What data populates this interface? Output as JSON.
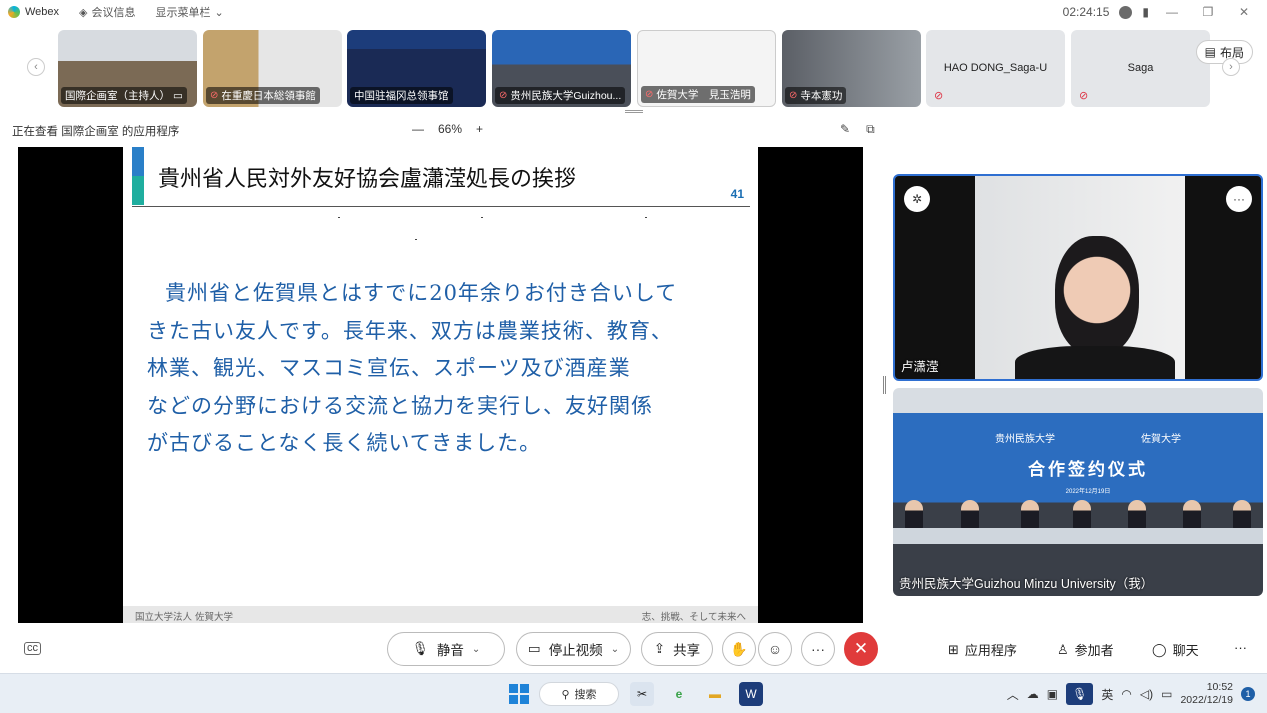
{
  "titlebar": {
    "app_name": "Webex",
    "meeting_info": "会议信息",
    "show_menu": "显示菜单栏",
    "timer": "02:24:15"
  },
  "thumbnails": [
    {
      "label": "国際企画室（主持人）"
    },
    {
      "label": "在重慶日本総領事館"
    },
    {
      "label": "中国驻福冈总领事馆"
    },
    {
      "label": "贵州民族大学Guizhou..."
    },
    {
      "label": "佐賀大学　見玉浩明"
    },
    {
      "label": "寺本憲功"
    },
    {
      "label": "HAO DONG_Saga-U"
    },
    {
      "label": "Saga"
    }
  ],
  "layout_label": "布局",
  "share": {
    "viewing_text": "正在查看 国際企画室 的应用程序",
    "zoom_minus": "—",
    "zoom_level": "66%",
    "zoom_plus": "+"
  },
  "slide": {
    "title": "貴州省人民対外友好協会盧瀟滢処長の挨拶",
    "page_number": "41",
    "body_lines": [
      "貴州省と佐賀県とはすでに20年余りお付き合いして",
      "きた古い友人です。長年来、双方は農業技術、教育、",
      "林業、観光、マスコミ宣伝、スポーツ及び酒産業",
      "などの分野における交流と協力を実行し、友好関係",
      "が古びることなく長く続いてきました。"
    ],
    "footer_left": "国立大学法人 佐賀大学",
    "footer_right": "志、挑戦、そして未来へ"
  },
  "videos": {
    "speaker_name": "卢潇滢",
    "room_name": "贵州民族大学Guizhou Minzu University（我）",
    "room_banner_left": "贵州民族大学",
    "room_banner_right": "佐賀大学",
    "room_banner_title": "合作签约仪式",
    "room_banner_date": "2022年12月19日"
  },
  "controls": {
    "mute": "静音",
    "stop_video": "停止视频",
    "share": "共享",
    "apps": "应用程序",
    "participants": "参加者",
    "chat": "聊天"
  },
  "taskbar": {
    "search": "搜索",
    "time": "10:52",
    "date": "2022/12/19",
    "notifications": "1",
    "ime": "英"
  }
}
